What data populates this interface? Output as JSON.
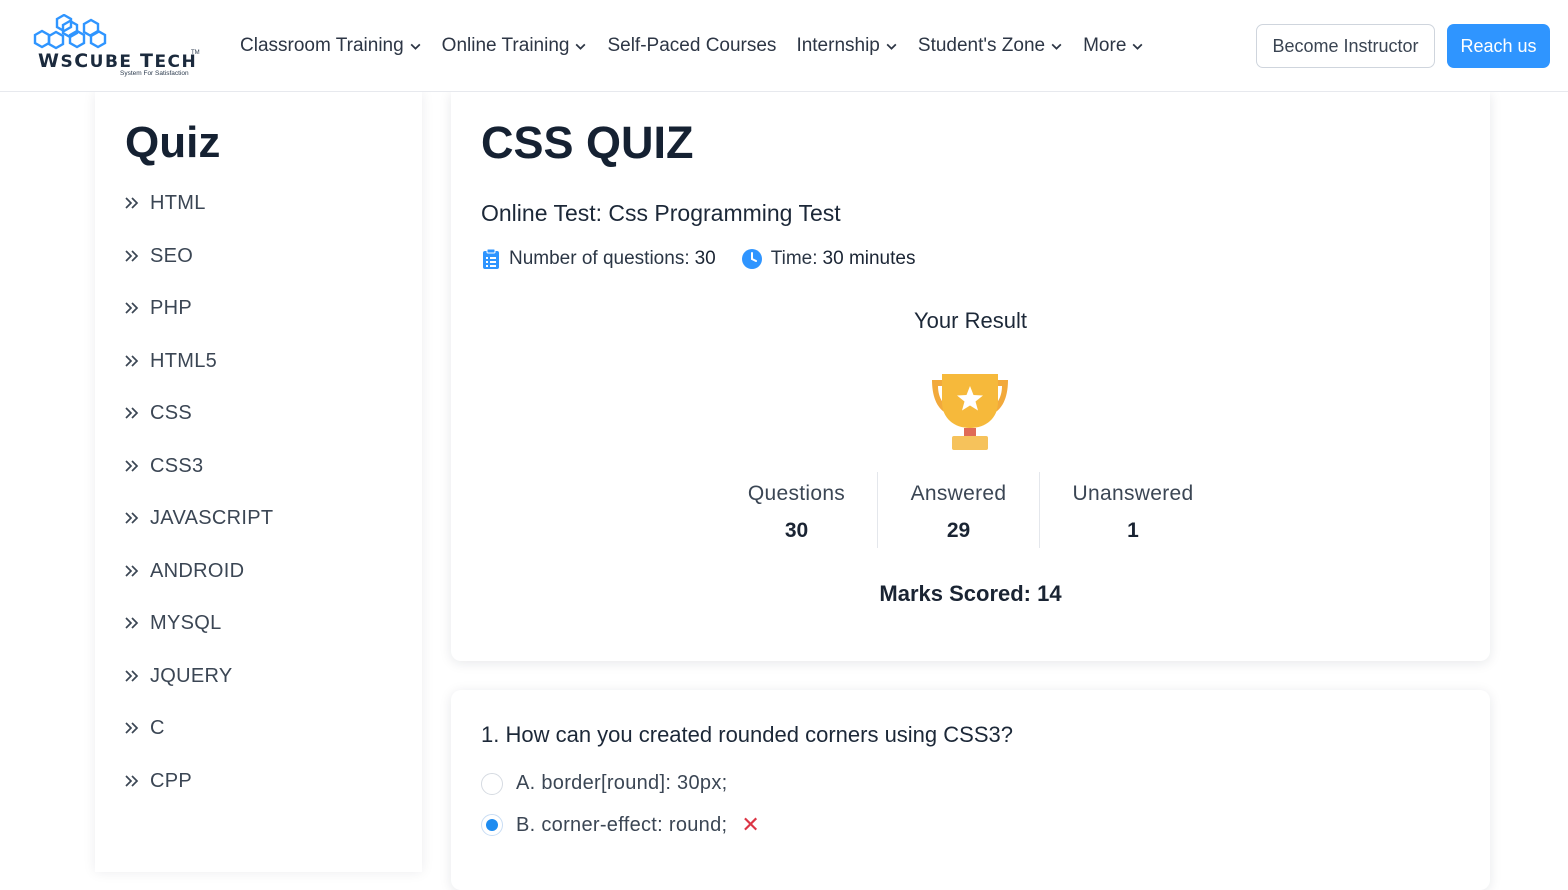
{
  "brand": {
    "logo_main": "WsCube Tech",
    "logo_ws": "W",
    "logo_s": "S",
    "logo_c": "C",
    "logo_ube": "UBE",
    "logo_t": "T",
    "logo_ech": "ECH",
    "tagline": "System For Satisfaction",
    "tm": "TM"
  },
  "nav": {
    "items": [
      {
        "label": "Classroom Training",
        "dropdown": true
      },
      {
        "label": "Online Training",
        "dropdown": true
      },
      {
        "label": "Self-Paced Courses",
        "dropdown": false
      },
      {
        "label": "Internship",
        "dropdown": true
      },
      {
        "label": "Student's Zone",
        "dropdown": true
      },
      {
        "label": "More",
        "dropdown": true
      }
    ],
    "become_instructor": "Become Instructor",
    "reach_us": "Reach us"
  },
  "sidebar": {
    "title": "Quiz",
    "items": [
      "HTML",
      "SEO",
      "PHP",
      "HTML5",
      "CSS",
      "CSS3",
      "JAVASCRIPT",
      "ANDROID",
      "MYSQL",
      "JQUERY",
      "C",
      "CPP"
    ]
  },
  "quiz": {
    "title": "CSS QUIZ",
    "subtitle": "Online Test: Css Programming Test",
    "questions_label": "Number of questions:",
    "questions_value": "30",
    "time_label": "Time:",
    "time_value": "30 minutes",
    "result_title": "Your Result",
    "stats": {
      "questions_label": "Questions",
      "questions_value": "30",
      "answered_label": "Answered",
      "answered_value": "29",
      "unanswered_label": "Unanswered",
      "unanswered_value": "1"
    },
    "marks": "Marks Scored: 14"
  },
  "question": {
    "text": "1. How can you created rounded corners using CSS3?",
    "options": [
      {
        "label": "A. border[round]: 30px;",
        "selected": false,
        "wrong": false
      },
      {
        "label": "B. corner-effect: round;",
        "selected": true,
        "wrong": true
      }
    ],
    "wrong_mark": "✕"
  },
  "colors": {
    "accent": "#2f95ff",
    "wrong": "#dc3545",
    "trophy": "#f6b93b"
  }
}
